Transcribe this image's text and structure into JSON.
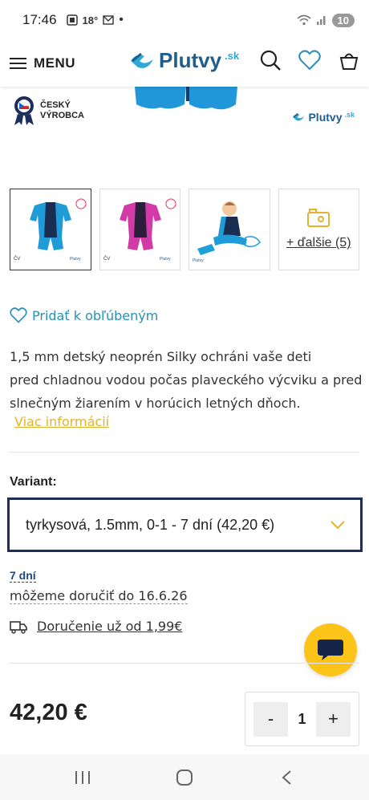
{
  "status_bar": {
    "time": "17:46",
    "temperature": "18°",
    "battery": "10"
  },
  "header": {
    "menu_label": "MENU",
    "logo_text": "Plutvy",
    "logo_tld": ".sk",
    "brand_color": "#1f5d8c",
    "accent_color": "#2fa8d8"
  },
  "hero": {
    "badge_line1": "ČESKÝ",
    "badge_line2": "VÝROBCA",
    "watermark_text": "Plutvy",
    "watermark_tld": ".sk"
  },
  "thumbnails": {
    "items": [
      {
        "name": "blue-wetsuit",
        "selected": true
      },
      {
        "name": "pink-wetsuit",
        "selected": false
      },
      {
        "name": "child-wearing-wetsuit",
        "selected": false
      }
    ],
    "more_label": "+ ďalšie (5)"
  },
  "favorites": {
    "label": "Pridať k obľúbeným"
  },
  "description": {
    "line1": "1,5 mm detský neoprén Silky ochráni vaše deti",
    "line2": "pred chladnou vodou počas plaveckého výcviku a pred",
    "line3": "slnečným žiarením v horúcich letných dňoch.",
    "more_info": "Viac informácií"
  },
  "variant": {
    "label": "Variant:",
    "selected_value": "tyrkysová, 1.5mm, 0-1 - 7 dní  (42,20 €)"
  },
  "availability": {
    "days": "7 dní",
    "delivery": "môžeme doručiť do 16.6.26",
    "shipping": "Doručenie už od 1,99€"
  },
  "purchase": {
    "price": "42,20 €",
    "qty_minus": "-",
    "qty_value": "1",
    "qty_plus": "+"
  },
  "colors": {
    "accent_yellow": "#fcc419",
    "link_yellow": "#e6b22e",
    "link_blue": "#2a8fb8",
    "select_border": "#1c2e5a"
  }
}
